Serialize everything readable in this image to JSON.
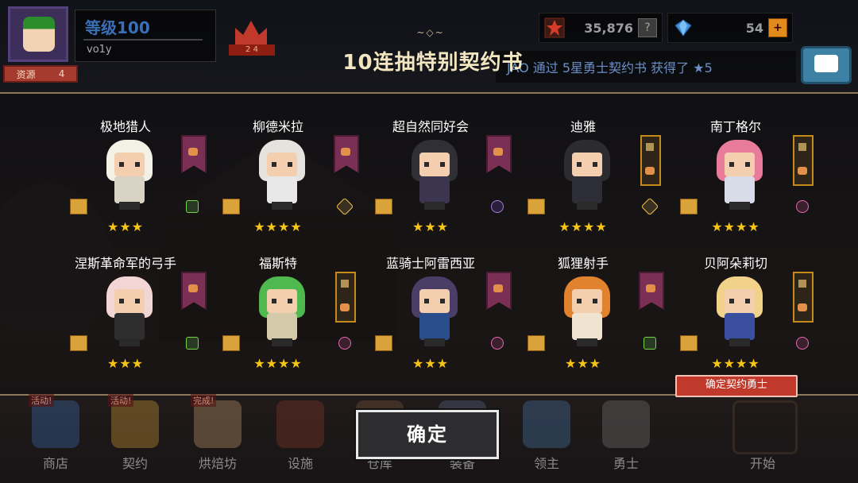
{
  "header": {
    "level_label": "等级100",
    "user_name": "vo1y",
    "rank_label": "资源",
    "rank_value": "4",
    "crown_badge": "2 4"
  },
  "currency": {
    "gold_value": "35,876",
    "gold_button": "?",
    "gem_value": "54",
    "gem_button": "+"
  },
  "ticker": {
    "text": "JAO 通过 5星勇士契约书 获得了 ★5"
  },
  "dialog": {
    "title_ornament": "~◇~",
    "title": "10连抽特别契约书",
    "confirm_tag": "确定契约勇士",
    "confirm_button": "确定"
  },
  "heroes": [
    {
      "name": "极地猎人",
      "stars": "★★★",
      "banner": "purple",
      "element": "green",
      "hair": "#f3f0e6",
      "outfit": "#d9d3c6"
    },
    {
      "name": "柳德米拉",
      "stars": "★★★★",
      "banner": "purple",
      "element": "yellow",
      "hair": "#e6e3df",
      "outfit": "#e8e8e8"
    },
    {
      "name": "超自然同好会",
      "stars": "★★★",
      "banner": "purple",
      "element": "violet",
      "hair": "#2f2f35",
      "outfit": "#3b3550"
    },
    {
      "name": "迪雅",
      "stars": "★★★★",
      "banner": "gold",
      "element": "yellow",
      "hair": "#2b2b30",
      "outfit": "#2e2e38"
    },
    {
      "name": "南丁格尔",
      "stars": "★★★★",
      "banner": "gold",
      "element": "pink",
      "hair": "#e87a9a",
      "outfit": "#d8dbe8"
    },
    {
      "name": "涅斯革命军的弓手",
      "stars": "★★★",
      "banner": "purple",
      "element": "green",
      "hair": "#f2d6d6",
      "outfit": "#2e2e2e"
    },
    {
      "name": "福斯特",
      "stars": "★★★★",
      "banner": "gold",
      "element": "pink",
      "hair": "#4fb84f",
      "outfit": "#d4c9a8"
    },
    {
      "name": "蓝骑士阿雷西亚",
      "stars": "★★★",
      "banner": "purple",
      "element": "pink",
      "hair": "#4a3e66",
      "outfit": "#2a4d8c"
    },
    {
      "name": "狐狸射手",
      "stars": "★★★",
      "banner": "purple",
      "element": "green",
      "hair": "#e0822e",
      "outfit": "#f0e4d0"
    },
    {
      "name": "贝阿朵莉切",
      "stars": "★★★★",
      "banner": "gold",
      "element": "pink",
      "hair": "#f2d28a",
      "outfit": "#3a4fa0"
    }
  ],
  "bottom_nav": [
    {
      "label": "商店",
      "badge": "活动!",
      "icon": "shop-icon"
    },
    {
      "label": "契约",
      "badge": "活动!",
      "icon": "contract-icon"
    },
    {
      "label": "烘焙坊",
      "badge": "完成!",
      "icon": "bakery-icon"
    },
    {
      "label": "设施",
      "badge": "",
      "icon": "facility-icon"
    },
    {
      "label": "仓库",
      "badge": "",
      "icon": "warehouse-icon"
    },
    {
      "label": "装备",
      "badge": "",
      "icon": "equipment-icon"
    },
    {
      "label": "领主",
      "badge": "",
      "icon": "lord-icon"
    },
    {
      "label": "勇士",
      "badge": "",
      "icon": "hero-icon"
    }
  ],
  "start": {
    "label": "开始"
  },
  "colors": {
    "gold": "#f5c518",
    "banner_purple": "#7a2f55",
    "banner_gold_border": "#c58a1a",
    "tag_red": "#c0392b"
  }
}
